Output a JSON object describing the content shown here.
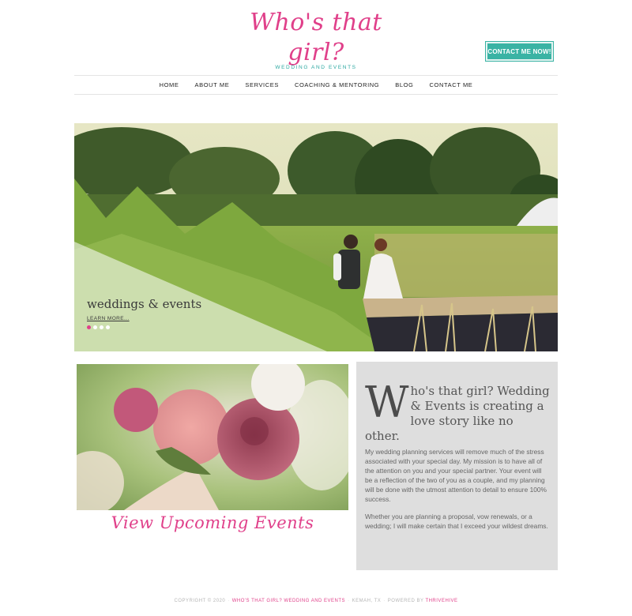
{
  "brand": {
    "name": "Who's that girl?",
    "tagline": "WEDDING AND EVENTS",
    "accent": "#e0408a",
    "teal": "#3ab3a4"
  },
  "header": {
    "cta_label": "CONTACT ME NOW!"
  },
  "nav": {
    "items": [
      {
        "label": "HOME"
      },
      {
        "label": "ABOUT ME"
      },
      {
        "label": "SERVICES"
      },
      {
        "label": "COACHING & MENTORING"
      },
      {
        "label": "BLOG"
      },
      {
        "label": "CONTACT ME"
      }
    ]
  },
  "hero": {
    "title": "weddings & events",
    "link": "LEARN MORE...",
    "slides": 4,
    "active_slide": 1
  },
  "events": {
    "link": "View Upcoming Events"
  },
  "about": {
    "dropcap": "W",
    "heading": "ho's that girl? Wedding & Events is creating a love story like no other.",
    "paragraphs": [
      "My wedding planning services will remove much of the stress associated with your special day. My mission is to have all of the attention on you and your special partner. Your event will be a reflection of the two of you as a couple, and my planning will be done with the utmost attention to detail to ensure 100% success.",
      "Whether you are planning a proposal, vow renewals, or a wedding; I will make certain that I exceed your wildest dreams."
    ]
  },
  "footer": {
    "copyright": "COPYRIGHT © 2020",
    "business": "WHO'S THAT GIRL? WEDDING AND EVENTS",
    "location": "KEMAH, TX",
    "powered_prefix": "POWERED BY",
    "powered_by": "THRIVEHIVE"
  }
}
